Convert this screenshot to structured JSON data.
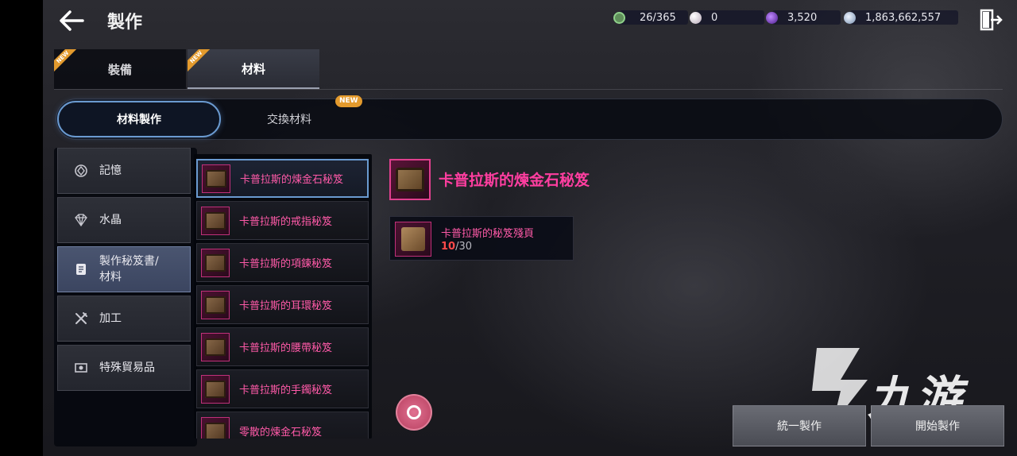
{
  "header": {
    "title": "製作",
    "currencies": [
      {
        "icon": "stamina-icon",
        "value": "26/365",
        "color": "#8fd08a"
      },
      {
        "icon": "pearl-icon",
        "value": "0",
        "color": "#d8d0d8"
      },
      {
        "icon": "purple-gem-icon",
        "value": "3,520",
        "color": "#8a3adf"
      },
      {
        "icon": "silver-coin-icon",
        "value": "1,863,662,557",
        "color": "#b8c8e0"
      }
    ]
  },
  "tabs": [
    {
      "label": "裝備",
      "badge": "NEW"
    },
    {
      "label": "材料",
      "badge": "NEW"
    }
  ],
  "subtabs": [
    {
      "label": "材料製作"
    },
    {
      "label": "交換材料",
      "badge": "NEW"
    }
  ],
  "categories": [
    {
      "label": "記憶",
      "icon": "memory-icon"
    },
    {
      "label": "水晶",
      "icon": "crystal-icon"
    },
    {
      "label": "製作秘笈書/",
      "label2": "材料",
      "icon": "scroll-icon"
    },
    {
      "label": "加工",
      "icon": "tools-icon"
    },
    {
      "label": "特殊貿易品",
      "icon": "trade-goods-icon"
    }
  ],
  "recipes": [
    {
      "name": "卡普拉斯的煉金石秘笈"
    },
    {
      "name": "卡普拉斯的戒指秘笈"
    },
    {
      "name": "卡普拉斯的項鍊秘笈"
    },
    {
      "name": "卡普拉斯的耳環秘笈"
    },
    {
      "name": "卡普拉斯的腰帶秘笈"
    },
    {
      "name": "卡普拉斯的手鐲秘笈"
    },
    {
      "name": "零散的煉金石秘笈"
    }
  ],
  "detail": {
    "title": "卡普拉斯的煉金石秘笈",
    "material": {
      "name": "卡普拉斯的秘笈殘頁",
      "have": "10",
      "sep": "/",
      "need": "30"
    }
  },
  "buttons": {
    "unify": "統一製作",
    "start": "開始製作"
  },
  "watermark": {
    "text": "九游"
  },
  "colors": {
    "accent": "#ff3ea0",
    "highlight": "#6a9ad0",
    "badge": "#e39a2d"
  }
}
